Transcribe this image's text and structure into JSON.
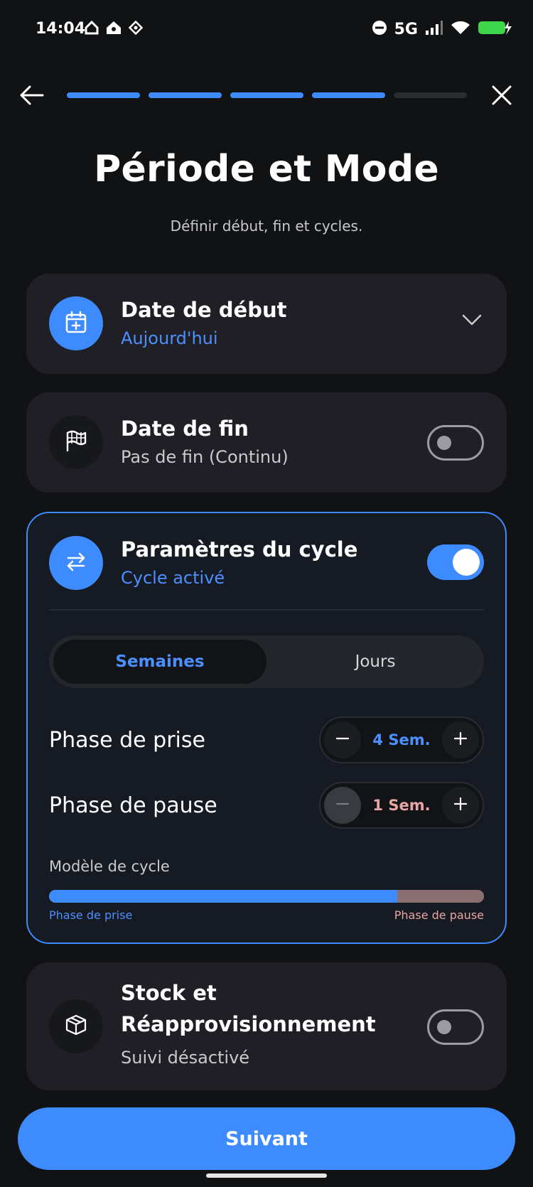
{
  "status_bar": {
    "time": "14:04",
    "network": "5G"
  },
  "progress": {
    "completed_steps": 4,
    "total_steps": 5
  },
  "header": {
    "title": "Période et Mode",
    "subtitle": "Définir début, fin et cycles."
  },
  "start_date": {
    "title": "Date de début",
    "value": "Aujourd'hui"
  },
  "end_date": {
    "title": "Date de fin",
    "value": "Pas de fin (Continu)",
    "enabled": false
  },
  "cycle": {
    "title": "Paramètres du cycle",
    "status": "Cycle activé",
    "enabled": true,
    "units": [
      "Semaines",
      "Jours"
    ],
    "selected_unit": "Semaines",
    "intake_phase": {
      "label": "Phase de prise",
      "value": "4 Sem."
    },
    "pause_phase": {
      "label": "Phase de pause",
      "value": "1 Sem."
    },
    "model_label": "Modèle de cycle",
    "model": {
      "take_weeks": 4,
      "pause_weeks": 1,
      "take_label": "Phase de prise",
      "pause_label": "Phase de pause"
    }
  },
  "stock": {
    "title_line1": "Stock et",
    "title_line2": "Réapprovisionnement",
    "status": "Suivi désactivé",
    "enabled": false
  },
  "footer": {
    "next_label": "Suivant"
  },
  "colors": {
    "accent": "#3E8BFF",
    "pause": "#8A6E72",
    "background": "#111214",
    "card": "#1F1F25"
  }
}
